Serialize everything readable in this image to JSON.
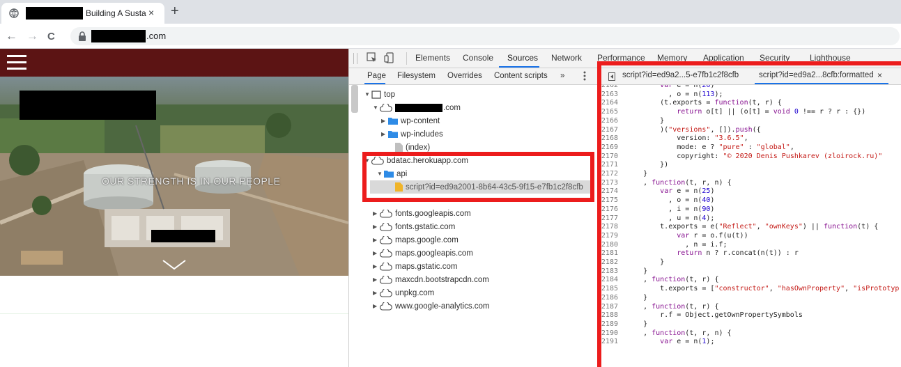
{
  "browser": {
    "tab_title": "Building A Susta",
    "tab_close": "×",
    "new_tab": "+",
    "url_suffix": ".com",
    "back": "←",
    "forward": "→",
    "reload": "C"
  },
  "page": {
    "hero_text": "OUR STRENGTH IS IN OUR PEOPLE"
  },
  "devtools": {
    "tabs": [
      "Elements",
      "Console",
      "Sources",
      "Network",
      "Performance",
      "Memory",
      "Application",
      "Security",
      "Lighthouse"
    ],
    "active_tab": "Sources",
    "nav_subtabs": [
      "Page",
      "Filesystem",
      "Overrides",
      "Content scripts",
      "»"
    ],
    "active_subtab": "Page",
    "tree": [
      {
        "label": "top",
        "arrow": "▼",
        "icon": "frame"
      },
      {
        "label": ".com",
        "arrow": "▼",
        "icon": "cloud",
        "redacted": true
      },
      {
        "label": "wp-content",
        "arrow": "▶",
        "icon": "folder"
      },
      {
        "label": "wp-includes",
        "arrow": "▶",
        "icon": "folder"
      },
      {
        "label": "(index)",
        "arrow": "",
        "icon": "file"
      },
      {
        "label": "bdatac.herokuapp.com",
        "arrow": "▼",
        "icon": "cloud"
      },
      {
        "label": "api",
        "arrow": "▼",
        "icon": "folder"
      },
      {
        "label": "script?id=ed9a2001-8b64-43c5-9f15-e7fb1c2f8cfb",
        "arrow": "",
        "icon": "file",
        "selected": true
      },
      {
        "label": "fonts.googleapis.com",
        "arrow": "▶",
        "icon": "cloud"
      },
      {
        "label": "fonts.gstatic.com",
        "arrow": "▶",
        "icon": "cloud"
      },
      {
        "label": "maps.google.com",
        "arrow": "▶",
        "icon": "cloud"
      },
      {
        "label": "maps.googleapis.com",
        "arrow": "▶",
        "icon": "cloud"
      },
      {
        "label": "maps.gstatic.com",
        "arrow": "▶",
        "icon": "cloud"
      },
      {
        "label": "maxcdn.bootstrapcdn.com",
        "arrow": "▶",
        "icon": "cloud"
      },
      {
        "label": "unpkg.com",
        "arrow": "▶",
        "icon": "cloud"
      },
      {
        "label": "www.google-analytics.com",
        "arrow": "▶",
        "icon": "cloud"
      }
    ],
    "editor_tabs": [
      {
        "label": "script?id=ed9a2...5-e7fb1c2f8cfb"
      },
      {
        "label": "script?id=ed9a2...8cfb:formatted",
        "close": "×"
      }
    ],
    "code": [
      {
        "n": "2162",
        "t": "        var e = n(26)"
      },
      {
        "n": "2163",
        "t": "          , o = n(113);"
      },
      {
        "n": "2164",
        "t": "        (t.exports = function(t, r) {"
      },
      {
        "n": "2165",
        "t": "            return o[t] || (o[t] = void 0 !== r ? r : {})"
      },
      {
        "n": "2166",
        "t": "        }"
      },
      {
        "n": "2167",
        "t": "        )(\"versions\", []).push({"
      },
      {
        "n": "2168",
        "t": "            version: \"3.6.5\","
      },
      {
        "n": "2169",
        "t": "            mode: e ? \"pure\" : \"global\","
      },
      {
        "n": "2170",
        "t": "            copyright: \"© 2020 Denis Pushkarev (zloirock.ru)\""
      },
      {
        "n": "2171",
        "t": "        })"
      },
      {
        "n": "2172",
        "t": "    }"
      },
      {
        "n": "2173",
        "t": "    , function(t, r, n) {"
      },
      {
        "n": "2174",
        "t": "        var e = n(25)"
      },
      {
        "n": "2175",
        "t": "          , o = n(40)"
      },
      {
        "n": "2176",
        "t": "          , i = n(90)"
      },
      {
        "n": "2177",
        "t": "          , u = n(4);"
      },
      {
        "n": "2178",
        "t": "        t.exports = e(\"Reflect\", \"ownKeys\") || function(t) {"
      },
      {
        "n": "2179",
        "t": "            var r = o.f(u(t))"
      },
      {
        "n": "2180",
        "t": "              , n = i.f;"
      },
      {
        "n": "2181",
        "t": "            return n ? r.concat(n(t)) : r"
      },
      {
        "n": "2182",
        "t": "        }"
      },
      {
        "n": "2183",
        "t": "    }"
      },
      {
        "n": "2184",
        "t": "    , function(t, r) {"
      },
      {
        "n": "2185",
        "t": "        t.exports = [\"constructor\", \"hasOwnProperty\", \"isPrototyp"
      },
      {
        "n": "2186",
        "t": "    }"
      },
      {
        "n": "2187",
        "t": "    , function(t, r) {"
      },
      {
        "n": "2188",
        "t": "        r.f = Object.getOwnPropertySymbols"
      },
      {
        "n": "2189",
        "t": "    }"
      },
      {
        "n": "2190",
        "t": "    , function(t, r, n) {"
      },
      {
        "n": "2191",
        "t": "        var e = n(1);"
      }
    ]
  },
  "colors": {
    "highlight_red": "#ec1c1c",
    "site_header": "#5c1414",
    "devtools_accent": "#1a73e8"
  }
}
